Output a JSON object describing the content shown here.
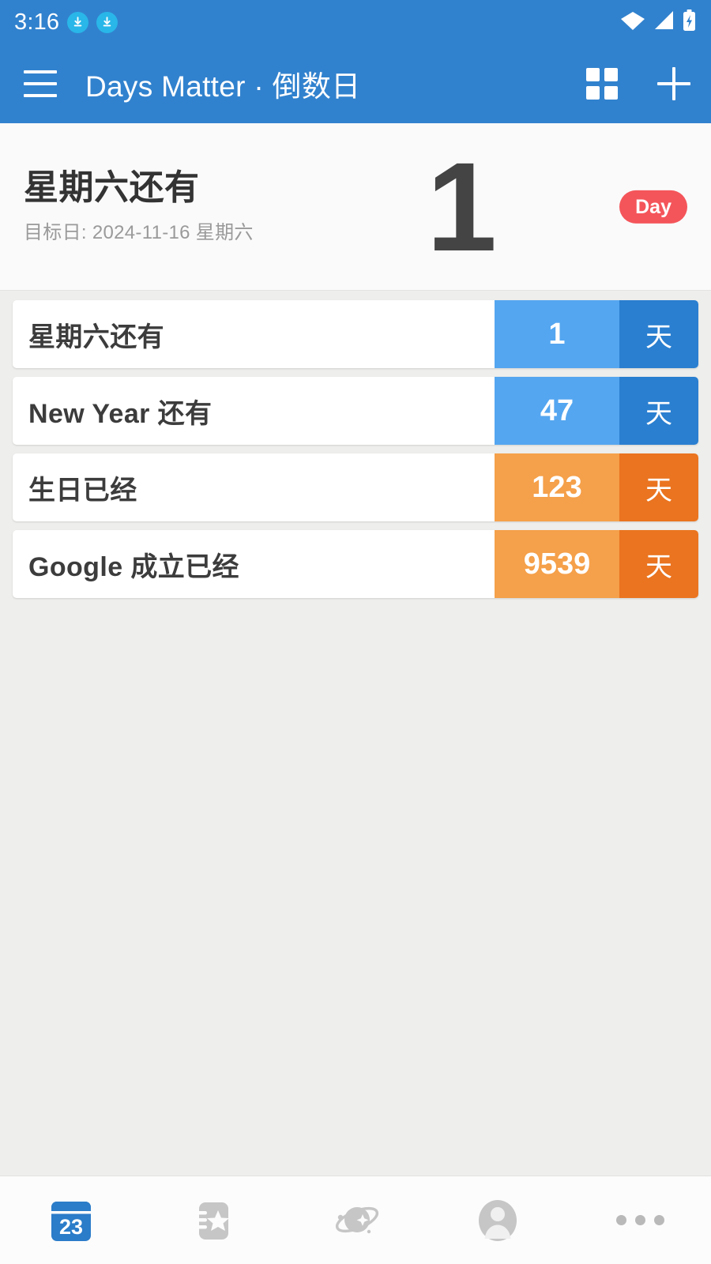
{
  "status_bar": {
    "time": "3:16",
    "icons": [
      "download-icon",
      "download-icon",
      "wifi-icon",
      "cell-signal-icon",
      "battery-charging-icon"
    ]
  },
  "toolbar": {
    "menu_icon": "hamburger-menu-icon",
    "title": "Days Matter · 倒数日",
    "grid_icon": "grid-view-icon",
    "add_icon": "plus-icon"
  },
  "hero": {
    "title": "星期六还有",
    "subtitle": "目标日: 2024-11-16 星期六",
    "number": "1",
    "badge": "Day",
    "badge_color": "#f4555a",
    "number_color": "#444444"
  },
  "events": [
    {
      "name": "星期六还有",
      "count": "1",
      "unit": "天",
      "kind": "future",
      "count_color": "#54a6f0",
      "unit_color": "#2a7fd0"
    },
    {
      "name": "New Year 还有",
      "count": "47",
      "unit": "天",
      "kind": "future",
      "count_color": "#54a6f0",
      "unit_color": "#2a7fd0"
    },
    {
      "name": "生日已经",
      "count": "123",
      "unit": "天",
      "kind": "past",
      "count_color": "#f5a04a",
      "unit_color": "#ea7420"
    },
    {
      "name": "Google 成立已经",
      "count": "9539",
      "unit": "天",
      "kind": "past",
      "count_color": "#f5a04a",
      "unit_color": "#ea7420"
    }
  ],
  "bottom_nav": {
    "items": [
      {
        "icon": "calendar-23-icon",
        "active": true
      },
      {
        "icon": "ticket-star-icon",
        "active": false
      },
      {
        "icon": "planet-icon",
        "active": false
      },
      {
        "icon": "person-avatar-icon",
        "active": false
      },
      {
        "icon": "more-dots-icon",
        "active": false
      }
    ],
    "active_color": "#2b7cc9",
    "inactive_color": "#c6c6c6"
  },
  "theme": {
    "primary": "#3182ce",
    "hero_bg": "#fafafa",
    "list_bg": "#eeeeec",
    "card_bg": "#ffffff"
  }
}
